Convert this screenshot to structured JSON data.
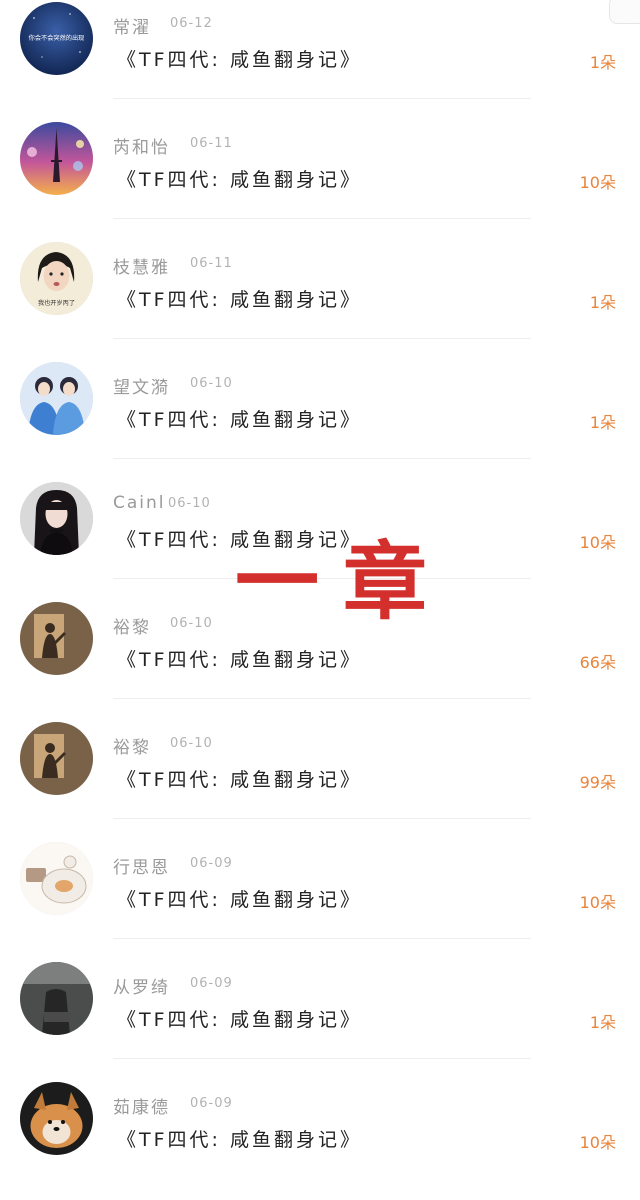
{
  "rows": [
    {
      "name": "常濯",
      "date": "06-12",
      "title": "《TF四代: 咸鱼翻身记》",
      "count": "1朵",
      "avatar_caption": "你会不会突然的出现"
    },
    {
      "name": "芮和怡",
      "date": "06-11",
      "title": "《TF四代: 咸鱼翻身记》",
      "count": "10朵"
    },
    {
      "name": "枝慧雅",
      "date": "06-11",
      "title": "《TF四代: 咸鱼翻身记》",
      "count": "1朵",
      "avatar_caption": "我也开岁丙了"
    },
    {
      "name": "望文漪",
      "date": "06-10",
      "title": "《TF四代: 咸鱼翻身记》",
      "count": "1朵"
    },
    {
      "name": "Cainl",
      "date": "06-10",
      "title": "《TF四代: 咸鱼翻身记》",
      "count": "10朵"
    },
    {
      "name": "裕黎",
      "date": "06-10",
      "title": "《TF四代: 咸鱼翻身记》",
      "count": "66朵"
    },
    {
      "name": "裕黎",
      "date": "06-10",
      "title": "《TF四代: 咸鱼翻身记》",
      "count": "99朵"
    },
    {
      "name": "行思恩",
      "date": "06-09",
      "title": "《TF四代: 咸鱼翻身记》",
      "count": "10朵"
    },
    {
      "name": "从罗绮",
      "date": "06-09",
      "title": "《TF四代: 咸鱼翻身记》",
      "count": "1朵"
    },
    {
      "name": "茹康德",
      "date": "06-09",
      "title": "《TF四代: 咸鱼翻身记》",
      "count": "10朵"
    }
  ],
  "overlay_text": "一章",
  "colors": {
    "accent": "#e8843b",
    "overlay": "#d3302d",
    "name": "#9a9a9a",
    "title": "#222222"
  }
}
